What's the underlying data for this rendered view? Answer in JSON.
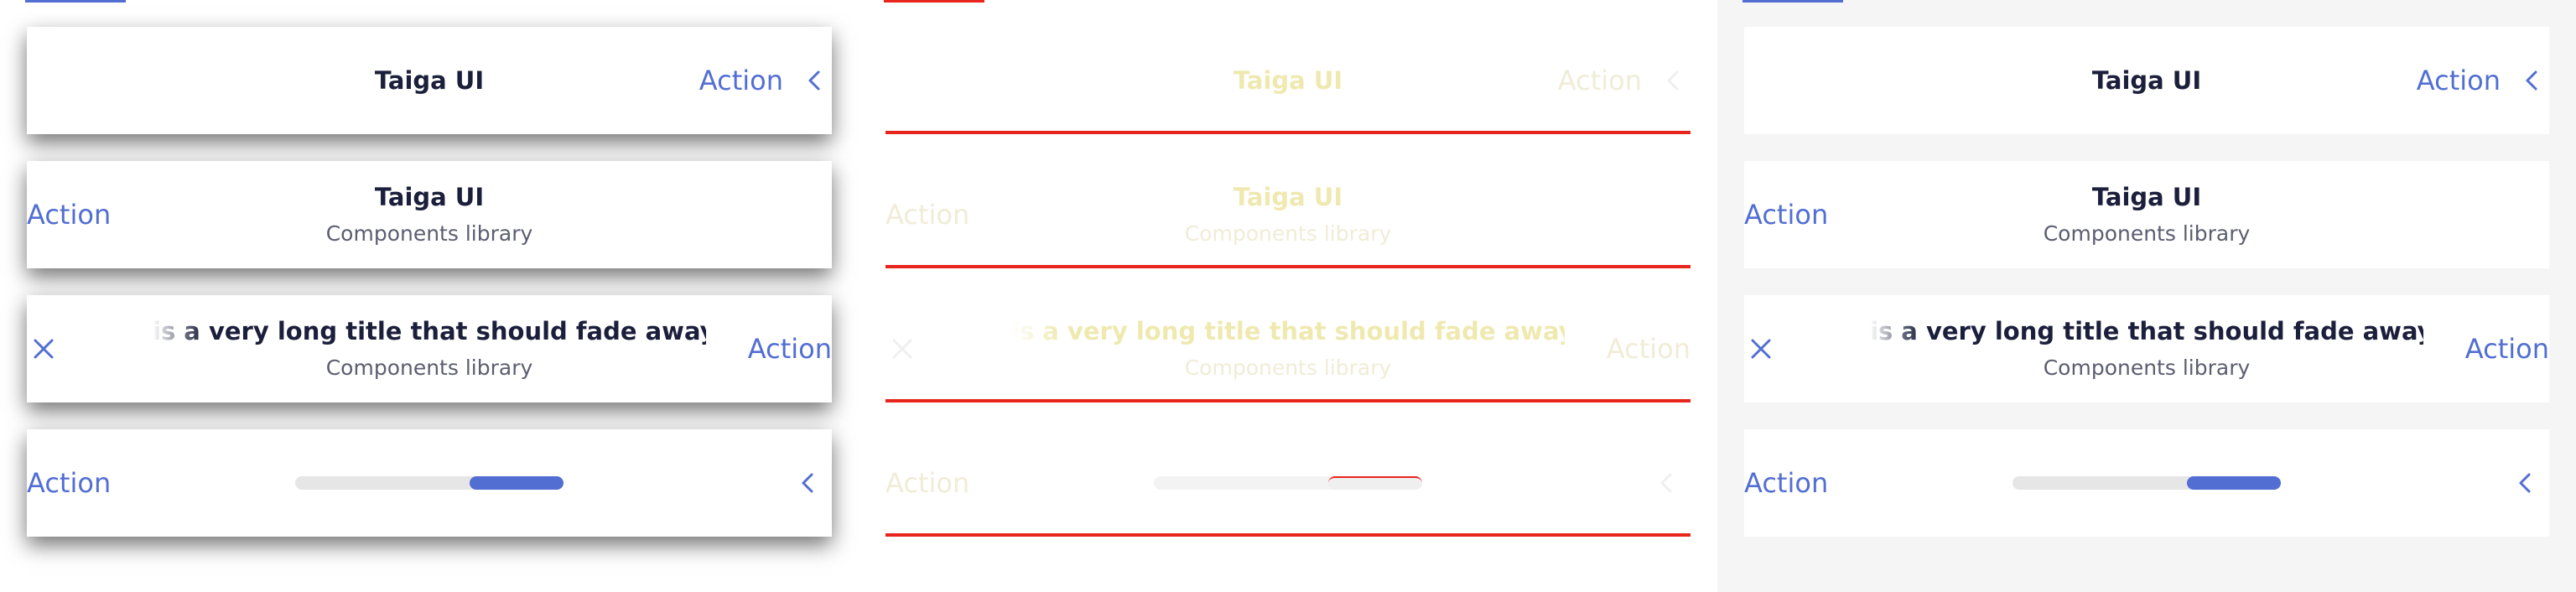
{
  "colors": {
    "accent": "#526ed3",
    "title": "#1b1f3b",
    "subtitle": "#5b5e70",
    "track": "#e6e6e6",
    "faint_text": "#efe9b0",
    "faint_underline": "#e8251d",
    "panel_background": "#f5f5f5"
  },
  "panels": [
    {
      "variant": "shadow",
      "bars": [
        {
          "kind": "title",
          "title": "Taiga UI",
          "action": "Action"
        },
        {
          "kind": "title-subtitle",
          "title": "Taiga UI",
          "subtitle": "Components library",
          "action": "Action"
        },
        {
          "kind": "long-title",
          "title": "is a very long title that should fade away",
          "subtitle": "Components library",
          "action": "Action"
        },
        {
          "kind": "progress",
          "action": "Action",
          "progress": 0.35
        }
      ]
    },
    {
      "variant": "outline",
      "bars": [
        {
          "kind": "title",
          "title": "Taiga UI",
          "action": "Action"
        },
        {
          "kind": "title-subtitle",
          "title": "Taiga UI",
          "subtitle": "Components library",
          "action": "Action"
        },
        {
          "kind": "long-title",
          "title": "is a very long title that should fade away",
          "subtitle": "Components library",
          "action": "Action"
        },
        {
          "kind": "progress",
          "action": "Action",
          "progress": 0.35
        }
      ]
    },
    {
      "variant": "flat",
      "bars": [
        {
          "kind": "title",
          "title": "Taiga UI",
          "action": "Action"
        },
        {
          "kind": "title-subtitle",
          "title": "Taiga UI",
          "subtitle": "Components library",
          "action": "Action"
        },
        {
          "kind": "long-title",
          "title": "is a very long title that should fade away",
          "subtitle": "Components library",
          "action": "Action"
        },
        {
          "kind": "progress",
          "action": "Action",
          "progress": 0.35
        }
      ]
    }
  ]
}
